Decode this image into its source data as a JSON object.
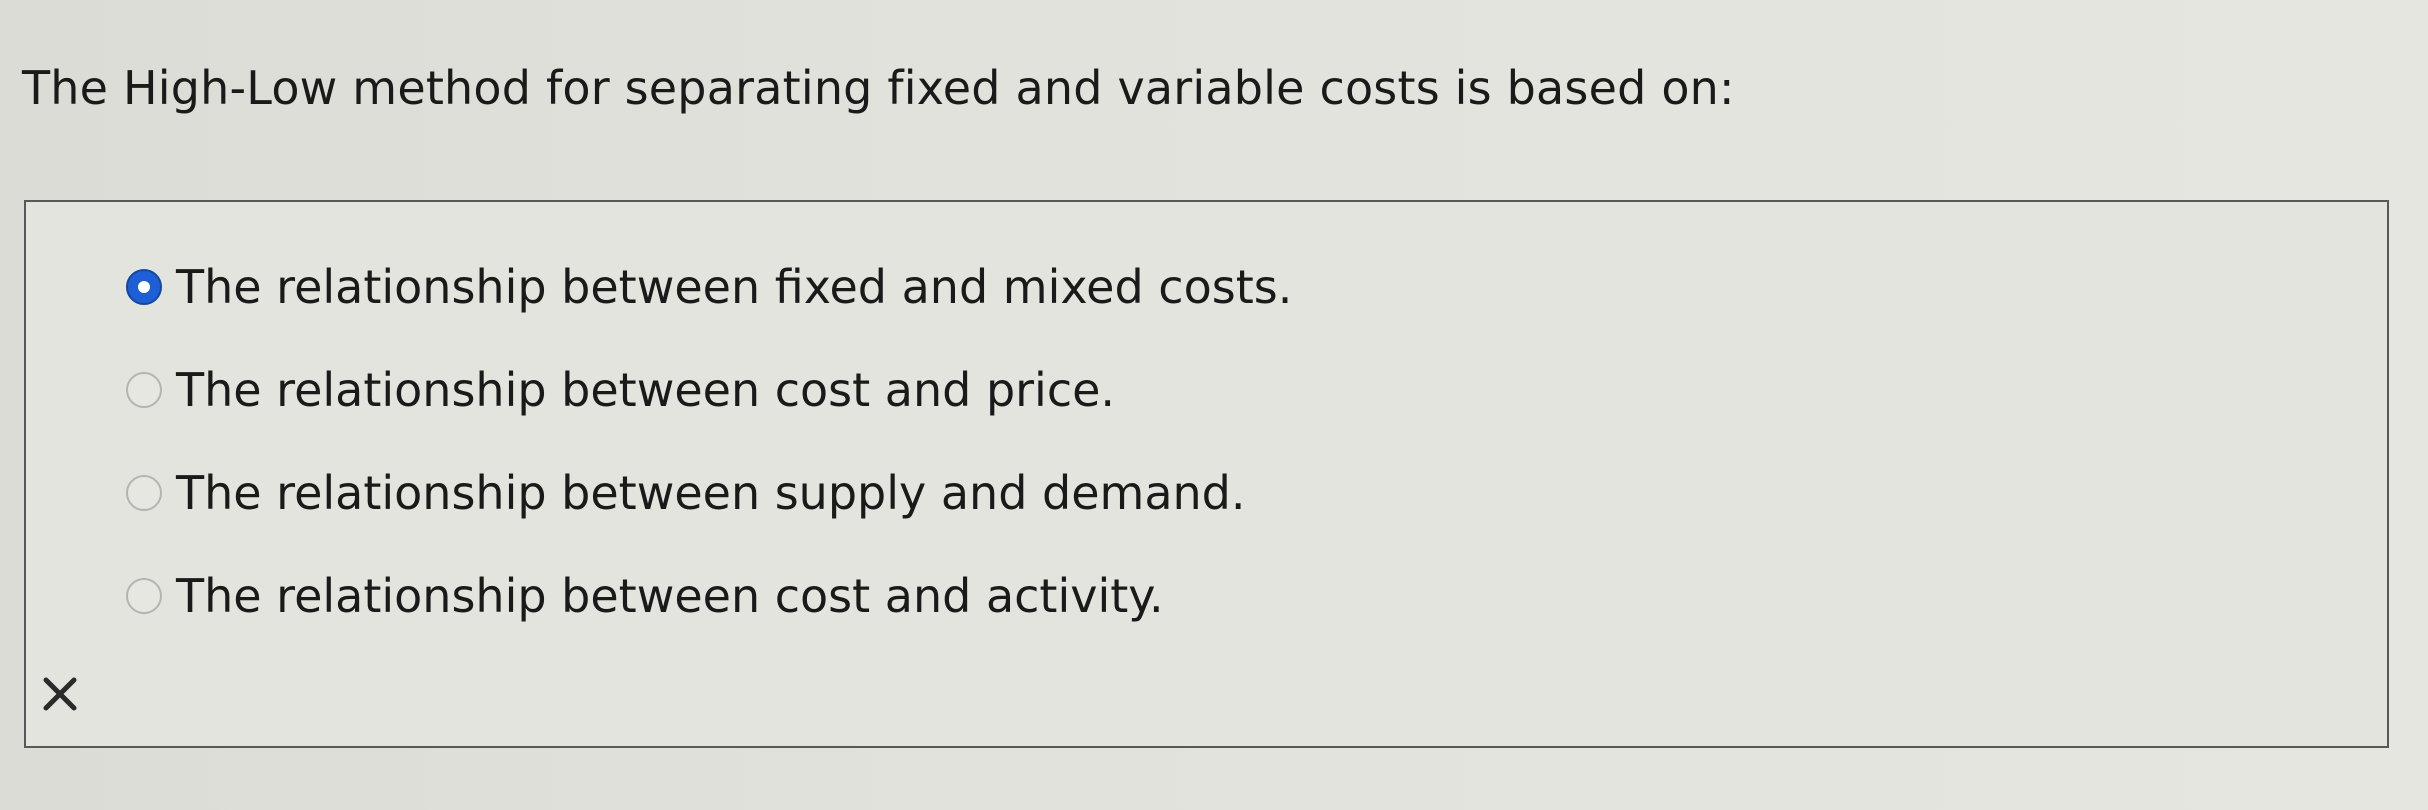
{
  "question": {
    "text": "The High-Low method for separating fixed and variable costs is based on:"
  },
  "options": [
    {
      "label": "The relationship between fixed and mixed costs.",
      "selected": true
    },
    {
      "label": "The relationship between cost and price.",
      "selected": false
    },
    {
      "label": "The relationship between supply and demand.",
      "selected": false
    },
    {
      "label": "The relationship between cost and activity.",
      "selected": false
    }
  ],
  "result": {
    "icon": "x-mark-icon",
    "status": "incorrect",
    "color": "#2a2a2a"
  },
  "colors": {
    "selected_radio": "#1f5fd6"
  }
}
